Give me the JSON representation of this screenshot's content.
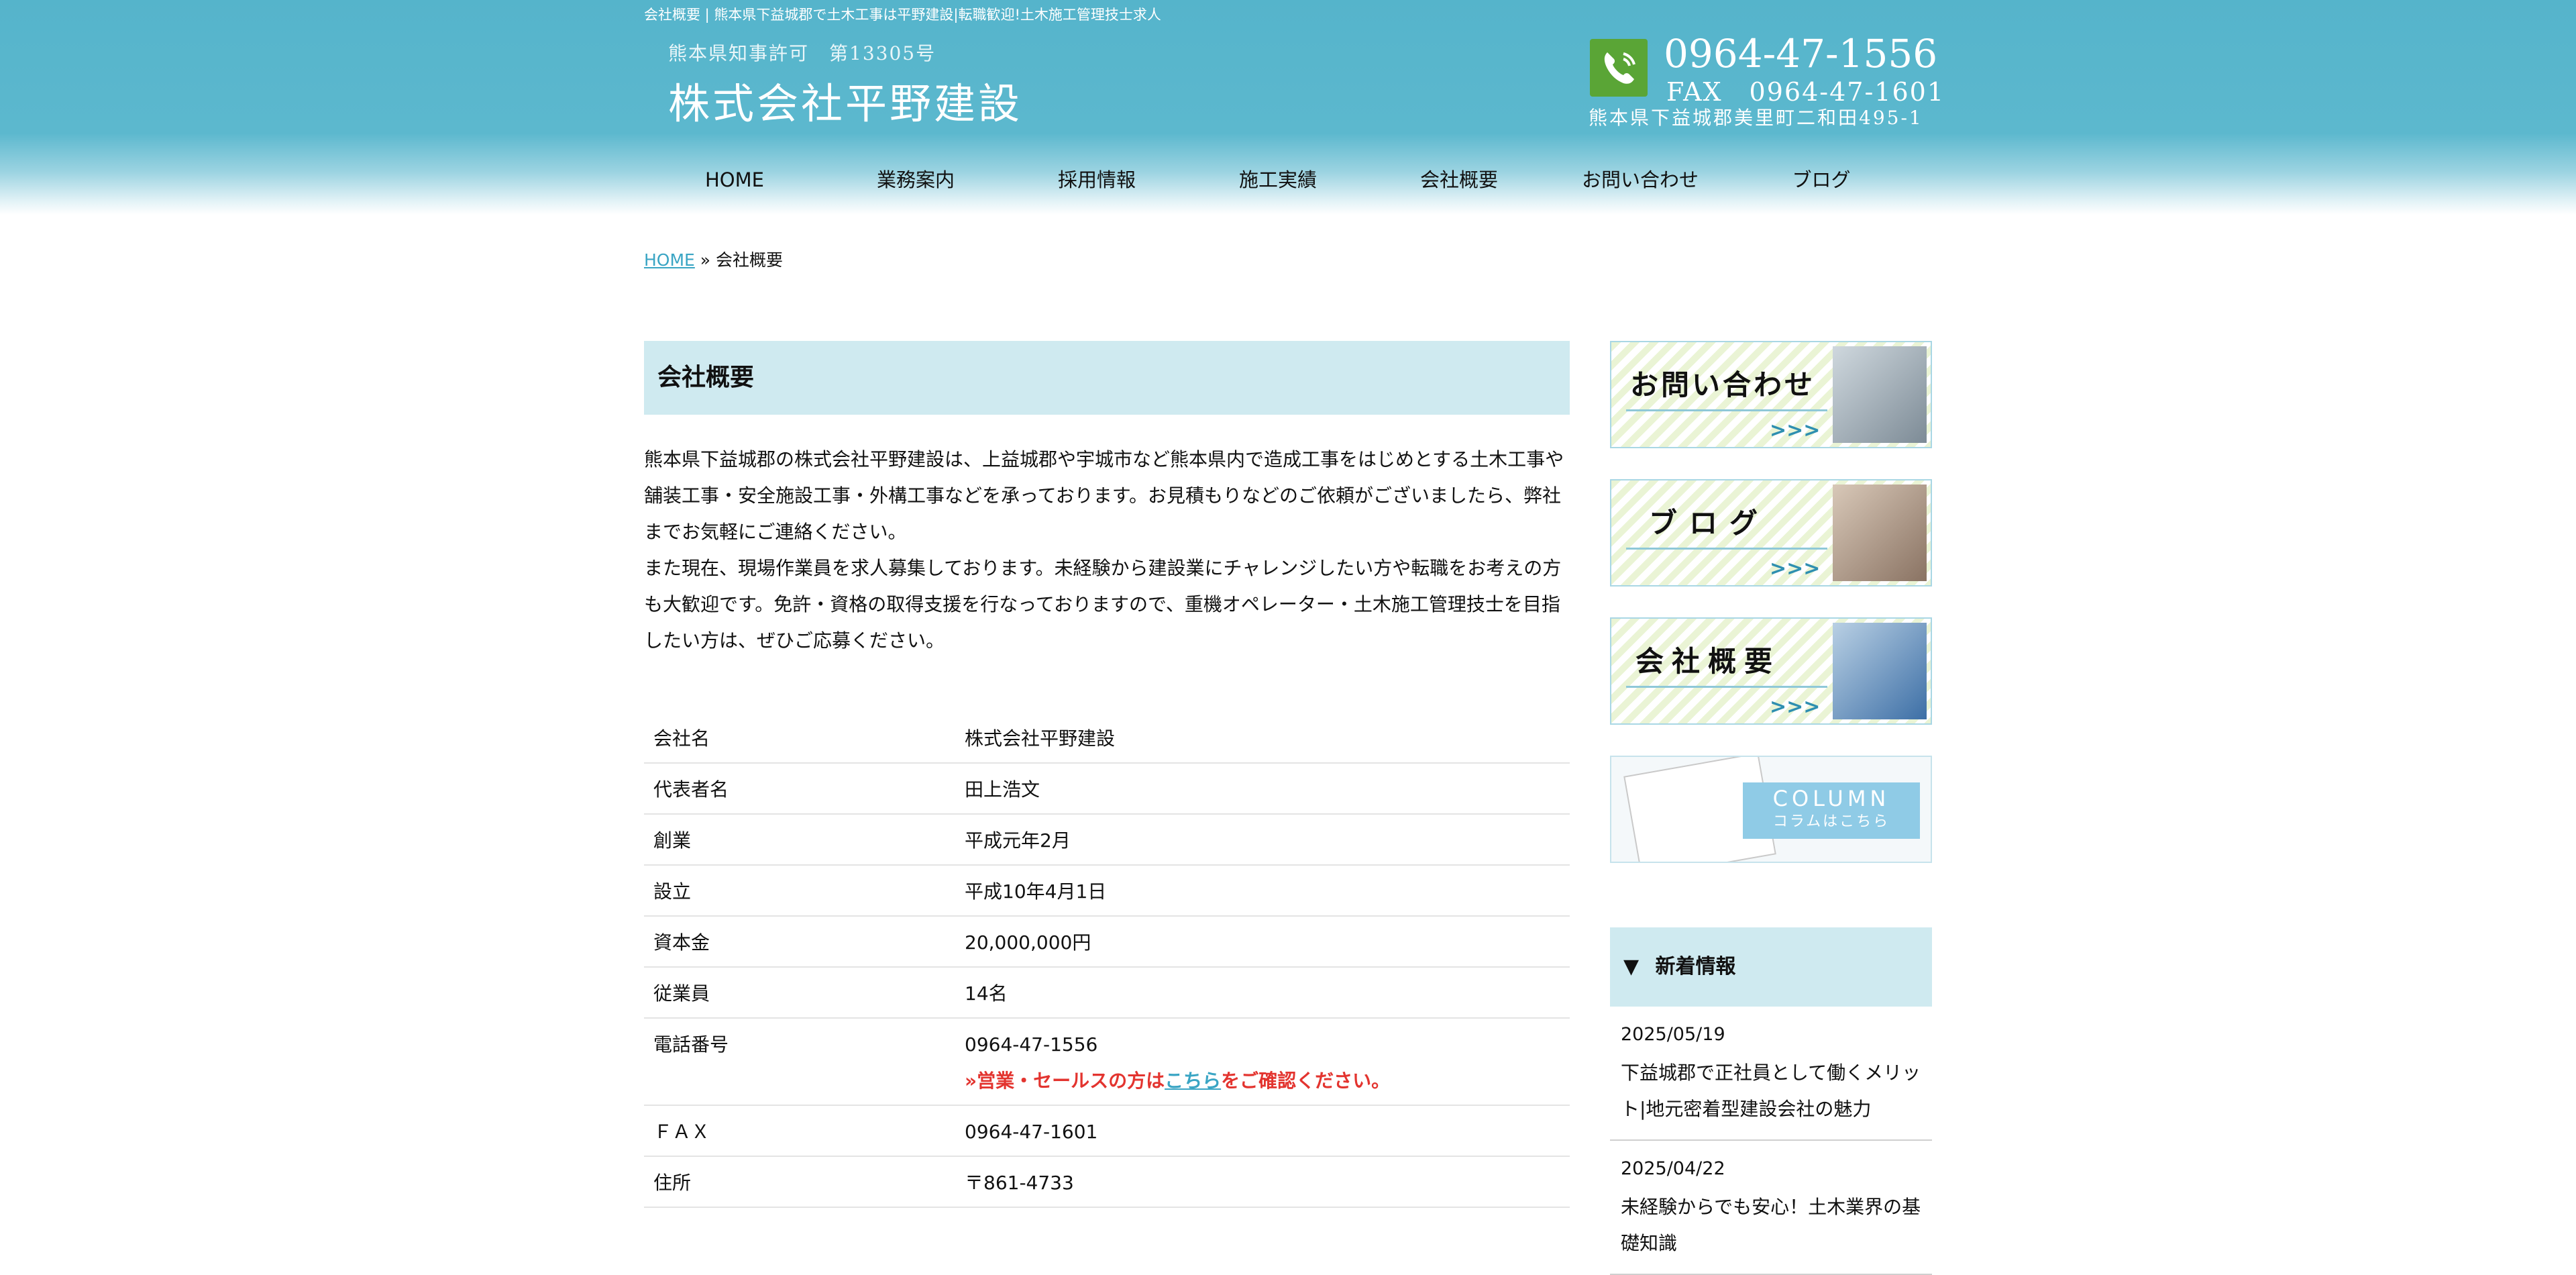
{
  "header": {
    "top_title": "会社概要 | 熊本県下益城郡で土木工事は平野建設|転職歓迎!土木施工管理技士求人",
    "license": "熊本県知事許可　第13305号",
    "company_logo": "株式会社平野建設",
    "tel": "0964-47-1556",
    "fax": "FAX　0964-47-1601",
    "address": "熊本県下益城郡美里町二和田495-1",
    "phone_icon": "phone-handset-icon"
  },
  "nav": {
    "items": [
      "HOME",
      "業務案内",
      "採用情報",
      "施工実績",
      "会社概要",
      "お問い合わせ",
      "ブログ"
    ]
  },
  "breadcrumb": {
    "home": "HOME",
    "separator": " » ",
    "current": "会社概要"
  },
  "main": {
    "title": "会社概要",
    "intro": [
      "熊本県下益城郡の株式会社平野建設は、上益城郡や宇城市など熊本県内で造成工事をはじめとする土木工事や舗装工事・安全施設工事・外構工事などを承っております。お見積もりなどのご依頼がございましたら、弊社までお気軽にご連絡ください。",
      "また現在、現場作業員を求人募集しております。未経験から建設業にチャレンジしたい方や転職をお考えの方も大歓迎です。免許・資格の取得支援を行なっておりますので、重機オペレーター・土木施工管理技士を目指したい方は、ぜひご応募ください。"
    ],
    "table": [
      {
        "label": "会社名",
        "value": "株式会社平野建設"
      },
      {
        "label": "代表者名",
        "value": "田上浩文"
      },
      {
        "label": "創業",
        "value": "平成元年2月"
      },
      {
        "label": "設立",
        "value": "平成10年4月1日"
      },
      {
        "label": "資本金",
        "value": "20,000,000円"
      },
      {
        "label": "従業員",
        "value": "14名"
      },
      {
        "label": "電話番号",
        "value": "0964-47-1556"
      },
      {
        "label": "ＦＡＸ",
        "value": "0964-47-1601"
      },
      {
        "label": "住所",
        "value": "〒861-4733"
      }
    ],
    "sales_note": {
      "prefix": "»営業・セールスの方は",
      "link": "こちら",
      "suffix": "をご確認ください。"
    }
  },
  "sidebar": {
    "banners": [
      {
        "label": "お問い合わせ"
      },
      {
        "label": "ブログ"
      },
      {
        "label": "会社概要"
      }
    ],
    "banner_arrows": ">>>",
    "column": {
      "en": "COLUMN",
      "jp": "コラムはこちら"
    },
    "news_header": "新着情報",
    "news_marker": "▼",
    "news": [
      {
        "date": "2025/05/19",
        "title": "下益城郡で正社員として働くメリット|地元密着型建設会社の魅力"
      },
      {
        "date": "2025/04/22",
        "title": "未経験からでも安心！土木業界の基礎知識"
      }
    ]
  }
}
